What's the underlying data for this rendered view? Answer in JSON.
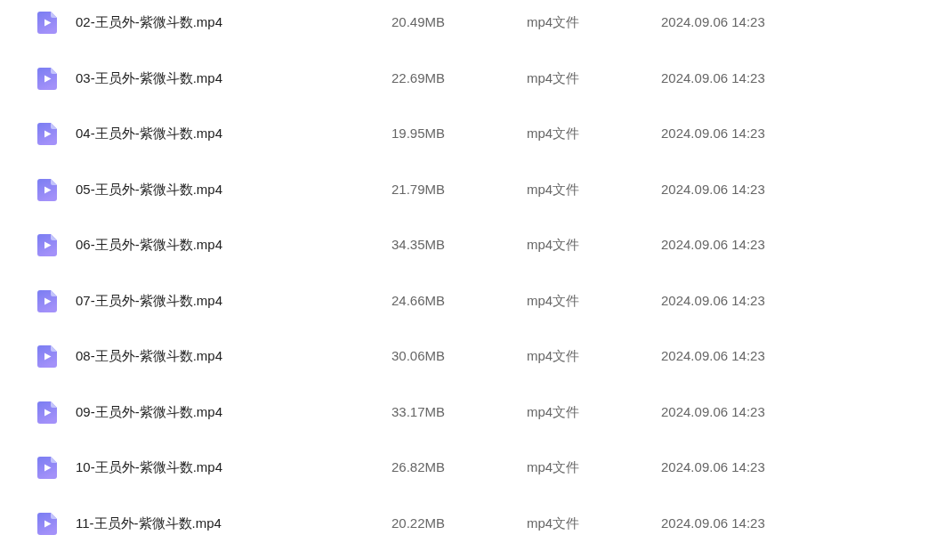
{
  "files": [
    {
      "name": "02-王员外-紫微斗数.mp4",
      "size": "20.49MB",
      "type": "mp4文件",
      "modified": "2024.09.06 14:23"
    },
    {
      "name": "03-王员外-紫微斗数.mp4",
      "size": "22.69MB",
      "type": "mp4文件",
      "modified": "2024.09.06 14:23"
    },
    {
      "name": "04-王员外-紫微斗数.mp4",
      "size": "19.95MB",
      "type": "mp4文件",
      "modified": "2024.09.06 14:23"
    },
    {
      "name": "05-王员外-紫微斗数.mp4",
      "size": "21.79MB",
      "type": "mp4文件",
      "modified": "2024.09.06 14:23"
    },
    {
      "name": "06-王员外-紫微斗数.mp4",
      "size": "34.35MB",
      "type": "mp4文件",
      "modified": "2024.09.06 14:23"
    },
    {
      "name": "07-王员外-紫微斗数.mp4",
      "size": "24.66MB",
      "type": "mp4文件",
      "modified": "2024.09.06 14:23"
    },
    {
      "name": "08-王员外-紫微斗数.mp4",
      "size": "30.06MB",
      "type": "mp4文件",
      "modified": "2024.09.06 14:23"
    },
    {
      "name": "09-王员外-紫微斗数.mp4",
      "size": "33.17MB",
      "type": "mp4文件",
      "modified": "2024.09.06 14:23"
    },
    {
      "name": "10-王员外-紫微斗数.mp4",
      "size": "26.82MB",
      "type": "mp4文件",
      "modified": "2024.09.06 14:23"
    },
    {
      "name": "11-王员外-紫微斗数.mp4",
      "size": "20.22MB",
      "type": "mp4文件",
      "modified": "2024.09.06 14:23"
    }
  ]
}
